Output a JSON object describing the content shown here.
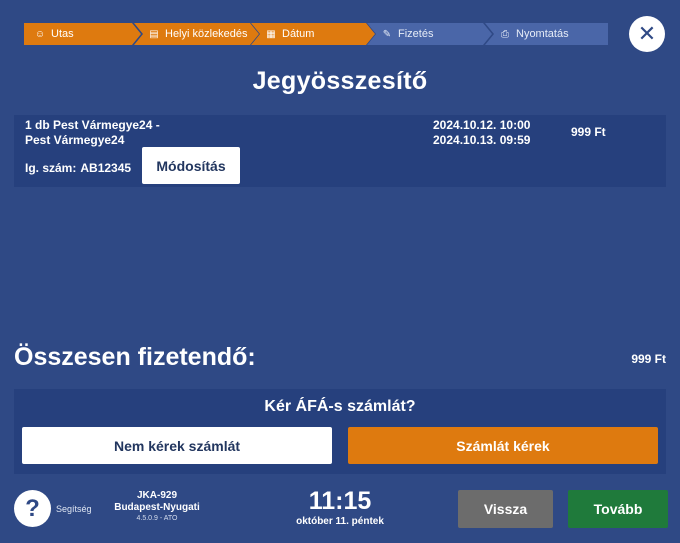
{
  "stepper": {
    "steps": [
      {
        "label": "Utas",
        "icon": "person-icon",
        "state": "active"
      },
      {
        "label": "Helyi közlekedés",
        "icon": "bus-icon",
        "state": "active"
      },
      {
        "label": "Dátum",
        "icon": "calendar-icon",
        "state": "active"
      },
      {
        "label": "Fizetés",
        "icon": "tickets-icon",
        "state": "inactive"
      },
      {
        "label": "Nyomtatás",
        "icon": "printer-icon",
        "state": "inactive"
      }
    ]
  },
  "header": {
    "close_symbol": "✕",
    "title": "Jegyösszesítő"
  },
  "ticket": {
    "name_line1": "1 db Pest Vármegye24 -",
    "name_line2": "Pest Vármegye24",
    "id_label": "Ig. szám:",
    "id_value": "AB12345",
    "modify_label": "Módosítás",
    "valid_from": "2024.10.12. 10:00",
    "valid_to": "2024.10.13. 09:59",
    "price": "999 Ft"
  },
  "total": {
    "label": "Összesen fizetendő:",
    "value": "999 Ft"
  },
  "invoice": {
    "question": "Kér ÁFÁ-s számlát?",
    "no_label": "Nem kérek számlát",
    "yes_label": "Számlát kérek"
  },
  "footer": {
    "help_symbol": "?",
    "help_label": "Segítség",
    "device_id": "JKA-929",
    "device_location": "Budapest-Nyugati",
    "device_version": "4.5.0.9 - ATO",
    "time": "11:15",
    "date": "október 11. péntek",
    "back_label": "Vissza",
    "next_label": "Tovább"
  },
  "colors": {
    "background": "#2f4985",
    "panel": "#26407d",
    "accent_orange": "#de7a0f",
    "inactive_step": "#4a66a8",
    "next_green": "#1f7a3b",
    "back_gray": "#6c6c6c"
  }
}
